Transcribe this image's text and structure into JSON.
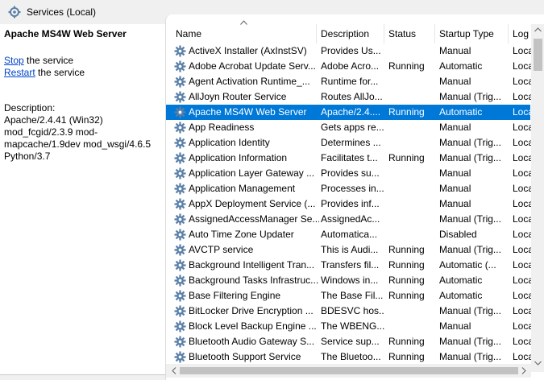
{
  "window": {
    "title": "Services (Local)"
  },
  "left_pane": {
    "title": "Apache MS4W Web Server",
    "actions": [
      {
        "link": "Stop",
        "rest": " the service"
      },
      {
        "link": "Restart",
        "rest": " the service"
      }
    ],
    "description_label": "Description:",
    "description": "Apache/2.4.41 (Win32) mod_fcgid/2.3.9 mod-mapcache/1.9dev mod_wsgi/4.6.5 Python/3.7"
  },
  "table": {
    "columns": [
      "Name",
      "Description",
      "Status",
      "Startup Type",
      "Log"
    ],
    "sort_column": "Name",
    "rows": [
      {
        "name": "ActiveX Installer (AxInstSV)",
        "description": "Provides Us...",
        "status": "",
        "startup": "Manual",
        "logon": "Loca"
      },
      {
        "name": "Adobe Acrobat Update Serv...",
        "description": "Adobe Acro...",
        "status": "Running",
        "startup": "Automatic",
        "logon": "Loca"
      },
      {
        "name": "Agent Activation Runtime_...",
        "description": "Runtime for...",
        "status": "",
        "startup": "Manual",
        "logon": "Loca"
      },
      {
        "name": "AllJoyn Router Service",
        "description": "Routes AllJo...",
        "status": "",
        "startup": "Manual (Trig...",
        "logon": "Loca"
      },
      {
        "name": "Apache MS4W Web Server",
        "description": "Apache/2.4....",
        "status": "Running",
        "startup": "Automatic",
        "logon": "Loca",
        "selected": true
      },
      {
        "name": "App Readiness",
        "description": "Gets apps re...",
        "status": "",
        "startup": "Manual",
        "logon": "Loca"
      },
      {
        "name": "Application Identity",
        "description": "Determines ...",
        "status": "",
        "startup": "Manual (Trig...",
        "logon": "Loca"
      },
      {
        "name": "Application Information",
        "description": "Facilitates t...",
        "status": "Running",
        "startup": "Manual (Trig...",
        "logon": "Loca"
      },
      {
        "name": "Application Layer Gateway ...",
        "description": "Provides su...",
        "status": "",
        "startup": "Manual",
        "logon": "Loca"
      },
      {
        "name": "Application Management",
        "description": "Processes in...",
        "status": "",
        "startup": "Manual",
        "logon": "Loca"
      },
      {
        "name": "AppX Deployment Service (...",
        "description": "Provides inf...",
        "status": "",
        "startup": "Manual",
        "logon": "Loca"
      },
      {
        "name": "AssignedAccessManager Se...",
        "description": "AssignedAc...",
        "status": "",
        "startup": "Manual (Trig...",
        "logon": "Loca"
      },
      {
        "name": "Auto Time Zone Updater",
        "description": "Automatica...",
        "status": "",
        "startup": "Disabled",
        "logon": "Loca"
      },
      {
        "name": "AVCTP service",
        "description": "This is Audi...",
        "status": "Running",
        "startup": "Manual (Trig...",
        "logon": "Loca"
      },
      {
        "name": "Background Intelligent Tran...",
        "description": "Transfers fil...",
        "status": "Running",
        "startup": "Automatic (...",
        "logon": "Loca"
      },
      {
        "name": "Background Tasks Infrastruc...",
        "description": "Windows in...",
        "status": "Running",
        "startup": "Automatic",
        "logon": "Loca"
      },
      {
        "name": "Base Filtering Engine",
        "description": "The Base Fil...",
        "status": "Running",
        "startup": "Automatic",
        "logon": "Loca"
      },
      {
        "name": "BitLocker Drive Encryption ...",
        "description": "BDESVC hos...",
        "status": "",
        "startup": "Manual (Trig...",
        "logon": "Loca"
      },
      {
        "name": "Block Level Backup Engine ...",
        "description": "The WBENG...",
        "status": "",
        "startup": "Manual",
        "logon": "Loca"
      },
      {
        "name": "Bluetooth Audio Gateway S...",
        "description": "Service sup...",
        "status": "Running",
        "startup": "Manual (Trig...",
        "logon": "Loca"
      },
      {
        "name": "Bluetooth Support Service",
        "description": "The Bluetoo...",
        "status": "Running",
        "startup": "Manual (Trig...",
        "logon": "Loca"
      }
    ]
  },
  "colors": {
    "selection": "#0078d7",
    "link": "#0044cc",
    "gear": "#5a7fa8"
  },
  "icons": {
    "service": "gear-icon",
    "window": "services-icon"
  }
}
